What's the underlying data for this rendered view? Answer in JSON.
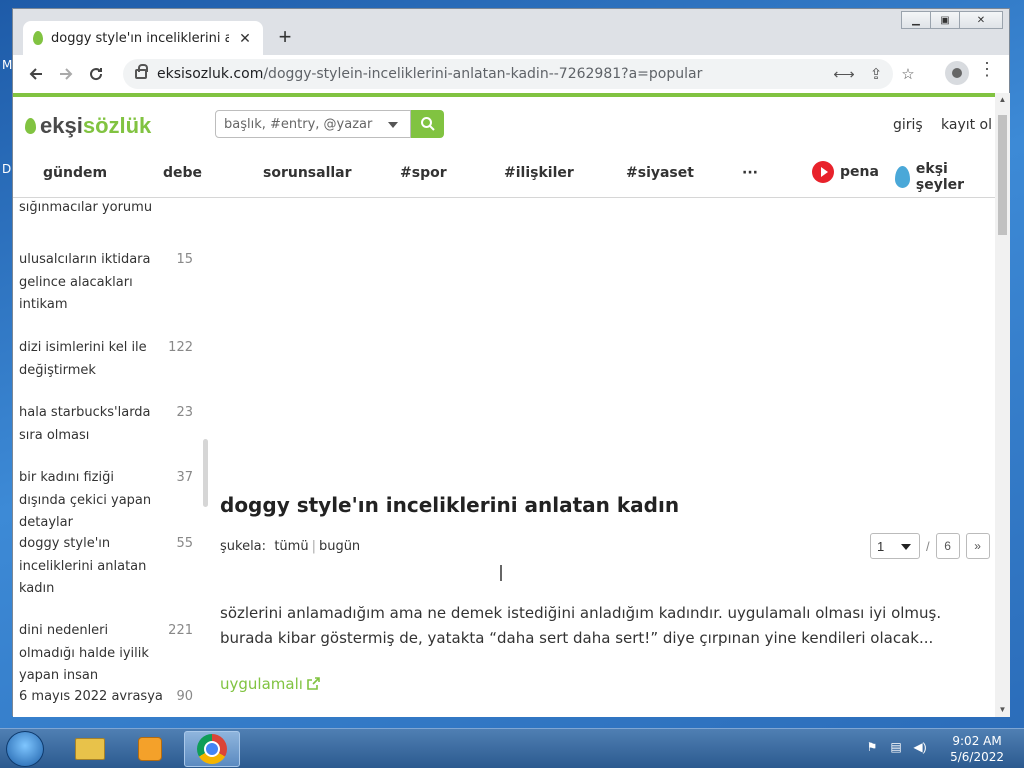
{
  "browser": {
    "tab_title": "doggy style'ın inceliklerini anlatan kadın",
    "url_domain": "eksisozluk.com",
    "url_path": "/doggy-stylein-inceliklerini-anlatan-kadin--7262981?a=popular"
  },
  "site": {
    "logo_part1": "ekşi",
    "logo_part2": "sözlük",
    "search_placeholder": "başlık, #entry, @yazar",
    "login": "giriş",
    "register": "kayıt ol"
  },
  "nav": {
    "items": [
      "gündem",
      "debe",
      "sorunsallar",
      "#spor",
      "#ilişkiler",
      "#siyaset",
      "···"
    ],
    "pena": "pena",
    "seyler": "ekşi şeyler"
  },
  "sidebar": {
    "partial_top": "sığınmacılar yorumu",
    "items": [
      {
        "title": "ulusalcıların iktidara gelince alacakları intikam",
        "count": "15"
      },
      {
        "title": "dizi isimlerini kel ile değiştirmek",
        "count": "122"
      },
      {
        "title": "hala starbucks'larda sıra olması",
        "count": "23"
      },
      {
        "title": "bir kadını fiziği dışında çekici yapan detaylar",
        "count": "37"
      },
      {
        "title": "doggy style'ın inceliklerini anlatan kadın",
        "count": "55"
      },
      {
        "title": "dini nedenleri olmadığı halde iyilik yapan insan",
        "count": "221"
      },
      {
        "title": "6 mayıs 2022 avrasya",
        "count": "90"
      }
    ]
  },
  "topic": {
    "title": "doggy style'ın inceliklerini anlatan kadın",
    "sukela_label": "şukela:",
    "filter_all": "tümü",
    "filter_today": "bugün",
    "page_current": "1",
    "page_total": "6",
    "next": "»"
  },
  "entry": {
    "text": "sözlerini anlamadığım ama ne demek istediğini anladığım kadındır. uygulamalı olması iyi olmuş. burada kibar göstermiş de, yatakta “daha sert daha sert!” diye çırpınan yine kendileri olacak...",
    "link_text": "uygulamalı"
  },
  "taskbar": {
    "time": "9:02 AM",
    "date": "5/6/2022"
  },
  "colors": {
    "brand_green": "#81c341",
    "pena_red": "#e8222b"
  }
}
